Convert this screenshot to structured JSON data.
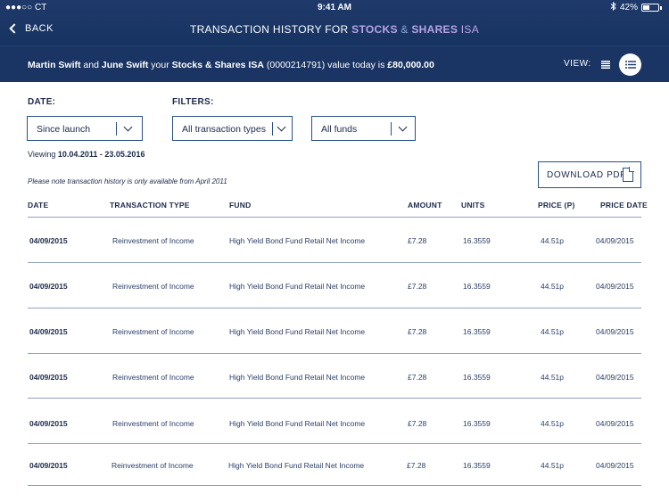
{
  "status_bar": {
    "carrier": "●●●○○ CT",
    "time": "9:41 AM",
    "battery": "42%"
  },
  "nav": {
    "back_label": "BACK",
    "title_prefix": "TRANSACTION HISTORY FOR ",
    "title_word1": "STOCKS",
    "title_amp": " & ",
    "title_word2": "SHARES",
    "title_suffix": " ISA"
  },
  "summary": {
    "name1": "Martin Swift",
    "and": " and ",
    "name2": "June Swift",
    "your": " your ",
    "account": "Stocks & Shares ISA",
    "account_no": " (0000214791) value today is ",
    "value": "£80,000.00",
    "view_label": "VIEW:"
  },
  "filters": {
    "date_label": "DATE:",
    "filters_label": "FILTERS:",
    "date_value": "Since launch",
    "type_value": "All transaction types",
    "fund_value": "All funds"
  },
  "viewing": {
    "prefix": "Viewing ",
    "range": "10.04.2011 - 23.05.2016"
  },
  "note": "Please note transaction history is only available from April 2011",
  "download_label": "DOWNLOAD PDF",
  "table": {
    "headers": [
      "DATE",
      "TRANSACTION TYPE",
      "FUND",
      "AMOUNT",
      "UNITS",
      "PRICE (P)",
      "PRICE DATE"
    ],
    "rows": [
      [
        "04/09/2015",
        "Reinvestment of Income",
        "High Yield Bond Fund Retail Net Income",
        "£7.28",
        "16.3559",
        "44.51p",
        "04/09/2015"
      ],
      [
        "04/09/2015",
        "Reinvestment of Income",
        "High Yield Bond Fund Retail Net Income",
        "£7.28",
        "16.3559",
        "44.51p",
        "04/09/2015"
      ],
      [
        "04/09/2015",
        "Reinvestment of Income",
        "High Yield Bond Fund Retail Net Income",
        "£7.28",
        "16.3559",
        "44.51p",
        "04/09/2015"
      ],
      [
        "04/09/2015",
        "Reinvestment of Income",
        "High Yield Bond Fund Retail Net Income",
        "£7.28",
        "16.3559",
        "44.51p",
        "04/09/2015"
      ],
      [
        "04/09/2015",
        "Reinvestment of Income",
        "High Yield Bond Fund Retail Net Income",
        "£7.28",
        "16.3559",
        "44.51p",
        "04/09/2015"
      ],
      [
        "04/09/2015",
        "Reinvestment of Income",
        "High Yield Bond Fund Retail Net Income",
        "£7.28",
        "16.3559",
        "44.51p",
        "04/09/2015"
      ]
    ]
  },
  "icons": {
    "back": "chevron-left-icon",
    "bluetooth": "bluetooth-icon",
    "battery": "battery-icon",
    "list_view": "list-view-icon",
    "detail_view": "detail-list-icon",
    "dropdown": "chevron-down-icon",
    "pdf": "document-icon"
  },
  "colors": {
    "nav_bg": "#1f3a6a",
    "summary_bg": "#1a3563",
    "title_highlight": "#b9a3e6",
    "border": "#2a4f86"
  }
}
